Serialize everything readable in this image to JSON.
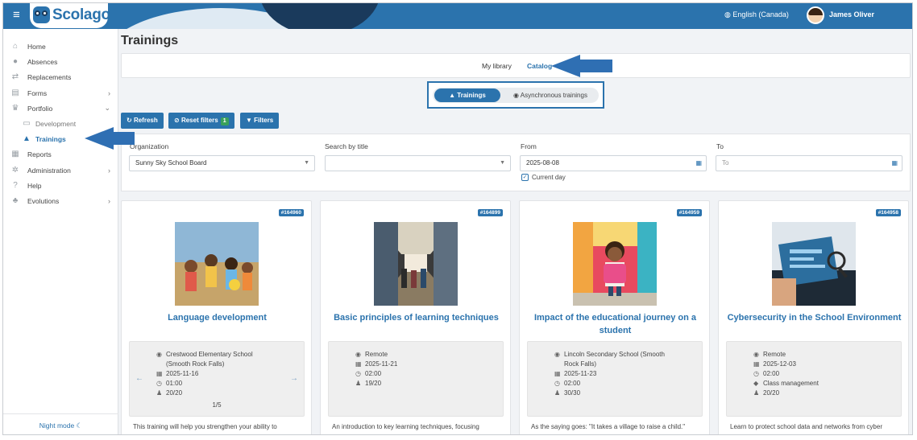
{
  "header": {
    "logo_text": "Scolago",
    "language": "English (Canada)",
    "user_name": "James Oliver"
  },
  "sidebar": {
    "items": [
      {
        "label": "Home",
        "icon": "home-icon"
      },
      {
        "label": "Absences",
        "icon": "person-icon"
      },
      {
        "label": "Replacements",
        "icon": "swap-icon"
      },
      {
        "label": "Forms",
        "icon": "document-icon",
        "chevron": "›"
      },
      {
        "label": "Portfolio",
        "icon": "trophy-icon",
        "chevron": "⌄"
      },
      {
        "label": "Development",
        "icon": "certificate-icon"
      },
      {
        "label": "Trainings",
        "icon": "graduation-cap-icon"
      },
      {
        "label": "Reports",
        "icon": "report-icon"
      },
      {
        "label": "Administration",
        "icon": "gear-icon",
        "chevron": "›"
      },
      {
        "label": "Help",
        "icon": "question-icon"
      },
      {
        "label": "Evolutions",
        "icon": "sprout-icon",
        "chevron": "›"
      }
    ],
    "night_mode": "Night mode ☾"
  },
  "page": {
    "title": "Trainings"
  },
  "library_tabs": {
    "my_library": "My library",
    "catalog": "Catalog"
  },
  "type_switch": {
    "trainings": "Trainings",
    "async": "Asynchronous trainings"
  },
  "toolbar": {
    "refresh": "Refresh",
    "reset_filters": "Reset filters",
    "reset_count": "1",
    "filters": "Filters"
  },
  "filters": {
    "organization_label": "Organization",
    "organization_value": "Sunny Sky School Board",
    "search_label": "Search by title",
    "search_value": "",
    "from_label": "From",
    "from_value": "2025-08-08",
    "to_label": "To",
    "to_placeholder": "To",
    "current_day": "Current day"
  },
  "cards": [
    {
      "id": "#164960",
      "title": "Language development",
      "location": "Crestwood Elementary School (Smooth Rock Falls)",
      "date": "2025-11-16",
      "duration": "01:00",
      "seats": "20/20",
      "pager": "1/5",
      "description": "This training will help you strengthen your ability to"
    },
    {
      "id": "#164899",
      "title": "Basic principles of learning techniques",
      "location": "Remote",
      "date": "2025-11-21",
      "duration": "02:00",
      "seats": "19/20",
      "description": "An introduction to key learning techniques, focusing"
    },
    {
      "id": "#164959",
      "title": "Impact of the educational journey on a student",
      "location": "Lincoln Secondary School (Smooth Rock Falls)",
      "date": "2025-11-23",
      "duration": "02:00",
      "seats": "30/30",
      "description": "As the saying goes: \"It takes a village to raise a child.\""
    },
    {
      "id": "#164958",
      "title": "Cybersecurity in the School Environment",
      "location": "Remote",
      "date": "2025-12-03",
      "duration": "02:00",
      "category": "Class management",
      "seats": "20/20",
      "description": "Learn to protect school data and networks from cyber"
    }
  ]
}
